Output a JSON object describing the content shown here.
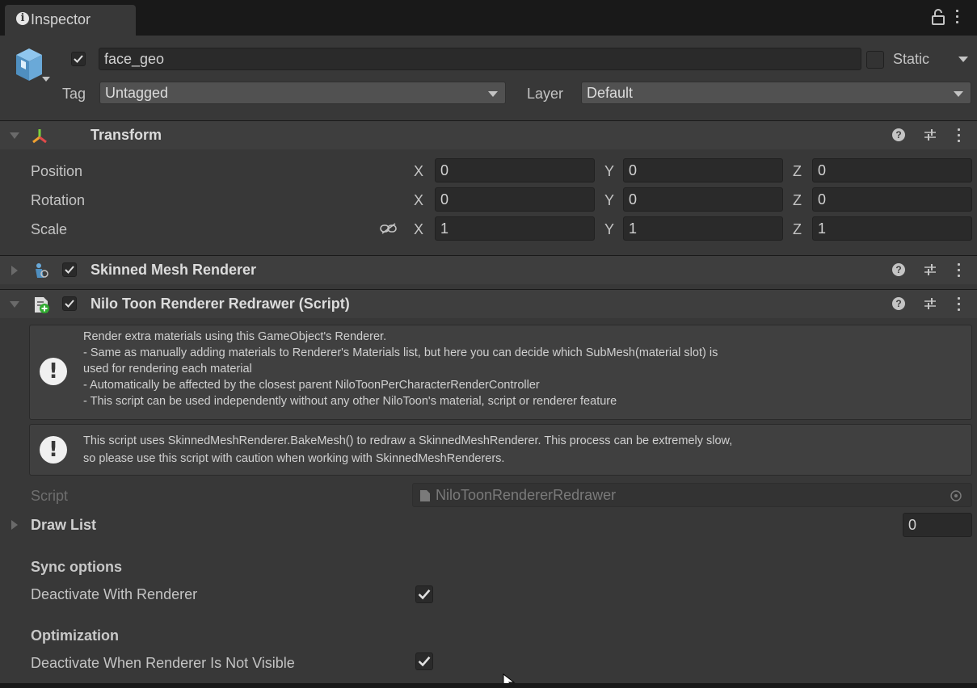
{
  "tab": {
    "label": "Inspector",
    "info_icon": "info-icon",
    "lock_icon": "lock-icon",
    "menu_icon": "kebab-menu-icon"
  },
  "gameobject": {
    "name": "face_geo",
    "active": true,
    "static_label": "Static",
    "static": false,
    "tag_label": "Tag",
    "tag_value": "Untagged",
    "layer_label": "Layer",
    "layer_value": "Default"
  },
  "transform": {
    "title": "Transform",
    "expanded": true,
    "rows": [
      {
        "label": "Position",
        "x": "0",
        "y": "0",
        "z": "0"
      },
      {
        "label": "Rotation",
        "x": "0",
        "y": "0",
        "z": "0"
      },
      {
        "label": "Scale",
        "x": "1",
        "y": "1",
        "z": "1"
      }
    ],
    "axis_x": "X",
    "axis_y": "Y",
    "axis_z": "Z"
  },
  "skinned_mesh": {
    "title": "Skinned Mesh Renderer",
    "enabled": true,
    "expanded": false
  },
  "redrawer": {
    "title": "Nilo Toon Renderer Redrawer (Script)",
    "enabled": true,
    "expanded": true,
    "info_lines": [
      "Render extra materials using this GameObject's Renderer.",
      "- Same as manually adding materials to Renderer's Materials list, but here you can decide which SubMesh(material slot) is",
      "used for rendering each material",
      "- Automatically be affected by the closest parent NiloToonPerCharacterRenderController",
      "- This script can be used independently without any other NiloToon's material, script or renderer feature"
    ],
    "warning_lines": [
      "This script uses SkinnedMeshRenderer.BakeMesh() to redraw a SkinnedMeshRenderer. This process can be extremely slow,",
      "so please use this script with caution when working with SkinnedMeshRenderers."
    ],
    "script_label": "Script",
    "script_value": "NiloToonRendererRedrawer",
    "draw_list_label": "Draw List",
    "draw_list_count": "0",
    "sync_title": "Sync options",
    "deactivate_with_renderer_label": "Deactivate With Renderer",
    "deactivate_with_renderer": true,
    "optimization_title": "Optimization",
    "deactivate_not_visible_label": "Deactivate When Renderer Is Not Visible",
    "deactivate_not_visible": true
  },
  "colors": {
    "background": "#383838",
    "header": "#3e3e3e",
    "field": "#2a2a2a",
    "text": "#c4c4c4"
  }
}
